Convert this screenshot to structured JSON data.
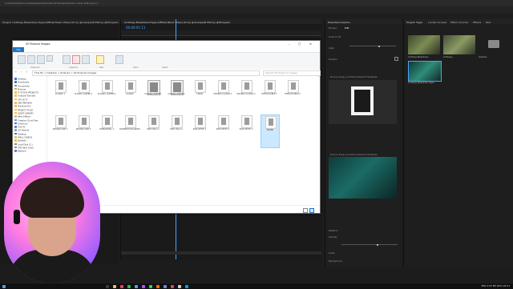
{
  "premiere": {
    "title": "C:\\Users\\Vb\\Documents\\Adobe\\Premiere Pro\\Projects\\Music Video Edit.prproj *",
    "menu": [
      "File",
      "Edit",
      "Clip",
      "Sequence",
      "Markers",
      "Graphics and Titles",
      "View",
      "Window",
      "Help"
    ],
    "workspace_tabs": [
      "Import",
      "Edit",
      "Export"
    ],
    "active_workspace": "Edit",
    "project_header": "Project: Lil Mosey Breakdown Hype (Official Music Video) Dir by @cineopedit Edit by @Himeyem",
    "sequence_tab": "Lil Mosey Breakdown Hype (Official Music Video) Dir by @cineopedit Edit by @Himeyem",
    "timecode": "00:00:01:11",
    "eg_title": "Essential Graphics",
    "eg_tabs": [
      "Browse",
      "Edit"
    ],
    "eg_layer_1": "Drop & Drag, and Move Polaroid Template",
    "eg_layer_2": "Drop & Drag, and Move Polaroid Template",
    "eg_labels": [
      "Scale to fit",
      "Align",
      "Position",
      "Rotation",
      "Opacity",
      "Scale",
      "Background"
    ],
    "project_tabs": [
      "Project: Hype",
      "Lumetri Scopes",
      "Effect Controls",
      "Effects",
      "Text"
    ],
    "project_items": [
      "Lil Mosey Breakdown...",
      "Lil Mosey...",
      "Lil Mosey...",
      "Graphics",
      "Lil Mosey Breakdown Hype..."
    ]
  },
  "explorer": {
    "title": "00 Polaroid Images",
    "file_tab": "File",
    "ribbon_tabs": [
      "Home",
      "Share",
      "View",
      "Picture Tools"
    ],
    "ribbon_groups": [
      "Clipboard",
      "Organize",
      "New",
      "Open",
      "Select"
    ],
    "path": "This PC > Desktop > Polaroid > 00 Polaroid Images",
    "search_placeholder": "Search 00 Polaroid Images",
    "nav_items": [
      "Desktop",
      "Downloads",
      "Documents",
      "Pictures",
      "LT STOCK PROJECTS",
      "Youtube Tutorials",
      "VFX IN YT",
      "CBS PREVIEW",
      "Premiere Pro",
      "PROJECT FILES",
      "ASSET LIBRARY",
      "After Effects",
      "Creative Cloud Files",
      "OneDrive",
      "This PC",
      "3D Objects",
      "Desktop",
      "FINAL VIDEOS",
      "Bullerfly",
      "Local Disk (C:)",
      "3TB Hard Drive",
      "Network"
    ],
    "files_row1": [
      "CLASSIC 1",
      "CLASSIC CARTER 1",
      "CLASSIC CARTER 2",
      "CLASSIC",
      "CLASSIC WHITE 1",
      "CLASSIC WHITE 2",
      "CLEAN",
      "DOUBLE CLASSIC 1",
      "DOUBLE CLASSIC 2",
      "EVER DOUBLE 1",
      "EVER DOUBLE 2"
    ],
    "files_row2": [
      "DOUBLE SIDE 1",
      "DOUBLE SIDE 2",
      "HORIZONTAL 1",
      "ROUNDED POLAROID",
      "SIDE HOLD 1",
      "SIDE HOLD 2",
      "SIDE WHITE 1",
      "SIDE WHITE 2",
      "SIDE WHITE 3",
      "BLANK"
    ],
    "status": "21 items   1 item selected  2.06 KB"
  },
  "taskbar": {
    "tray_time": "4:25 PM",
    "tray_date": "2021-02-21",
    "tray_label": "ENG"
  },
  "colors": {
    "accent": "#4aa3ff",
    "explorer_file_tab": "#1e74c9",
    "selection": "#cce8ff"
  }
}
